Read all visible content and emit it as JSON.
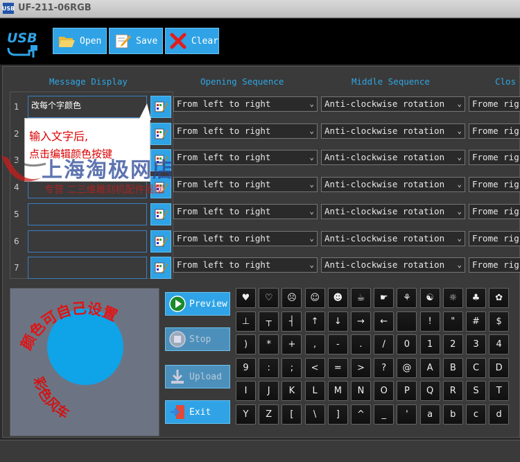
{
  "window": {
    "title": "UF-211-06RGB",
    "app_icon": "USB"
  },
  "toolbar": {
    "open_label": "Open",
    "save_label": "Save",
    "clear_label": "Clear",
    "logo_text": "USB"
  },
  "columns": {
    "message": "Message Display",
    "opening": "Opening Sequence",
    "middle": "Middle Sequence",
    "closing": "Clos"
  },
  "rows": [
    {
      "num": "1",
      "message": "改每个字颜色",
      "opening": "From left to right",
      "middle": "Anti-clockwise rotation",
      "closing": "Frome rig"
    },
    {
      "num": "2",
      "message": "",
      "opening": "From left to right",
      "middle": "Anti-clockwise rotation",
      "closing": "Frome rig"
    },
    {
      "num": "3",
      "message": "",
      "opening": "From left to right",
      "middle": "Anti-clockwise rotation",
      "closing": "Frome rig"
    },
    {
      "num": "4",
      "message": "",
      "opening": "From left to right",
      "middle": "Anti-clockwise rotation",
      "closing": "Frome rig"
    },
    {
      "num": "5",
      "message": "",
      "opening": "From left to right",
      "middle": "Anti-clockwise rotation",
      "closing": "Frome rig"
    },
    {
      "num": "6",
      "message": "",
      "opening": "From left to right",
      "middle": "Anti-clockwise rotation",
      "closing": "Frome rig"
    },
    {
      "num": "7",
      "message": "",
      "opening": "From left to right",
      "middle": "Anti-clockwise rotation",
      "closing": "Frome rig"
    }
  ],
  "tooltip": {
    "line1": "输入文字后,",
    "line2": "点击编辑颜色按键"
  },
  "watermark": {
    "main": "上海淘极网店",
    "sub": "专营 二三维雕刻机配件摇摆"
  },
  "preview": {
    "arc_text": "颜色可自己设置",
    "arc_text2": "彩色风车"
  },
  "controls": {
    "preview_label": "Preview",
    "stop_label": "Stop",
    "upload_label": "Upload",
    "exit_label": "Exit"
  },
  "symbols": [
    [
      "♥",
      "♡",
      "☹",
      "☺",
      "☻",
      "☕",
      "☛",
      "⚘",
      "☯",
      "☼",
      "♣",
      "✿"
    ],
    [
      "⊥",
      "┬",
      "┤",
      "↑",
      "↓",
      "→",
      "←",
      "",
      "!",
      "\"",
      "#",
      "$"
    ],
    [
      ")",
      "*",
      "+",
      ",",
      "-",
      ".",
      "/",
      "0",
      "1",
      "2",
      "3",
      "4"
    ],
    [
      "9",
      ":",
      ";",
      "<",
      "=",
      ">",
      "?",
      "@",
      "A",
      "B",
      "C",
      "D"
    ],
    [
      "I",
      "J",
      "K",
      "L",
      "M",
      "N",
      "O",
      "P",
      "Q",
      "R",
      "S",
      "T"
    ],
    [
      "Y",
      "Z",
      "[",
      "\\",
      "]",
      "^",
      "_",
      "'",
      "a",
      "b",
      "c",
      "d"
    ]
  ],
  "colors": {
    "accent": "#2fa3e6",
    "header_text": "#2ea6e4",
    "preview_bg": "#6c7484",
    "disc": "#0fa3e8"
  }
}
